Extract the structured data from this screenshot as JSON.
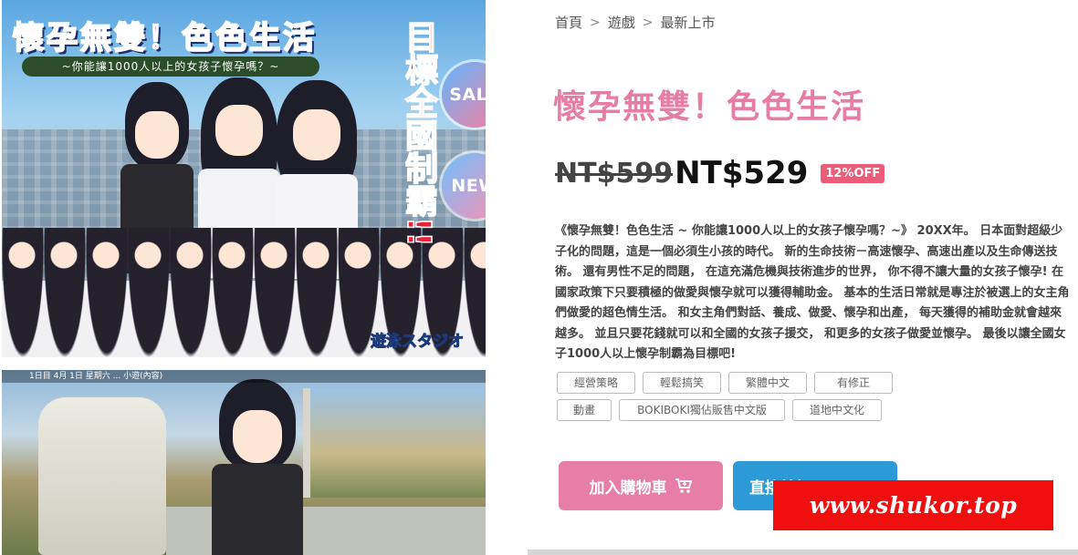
{
  "breadcrumb": {
    "items": [
      "首頁",
      "遊戲",
      "最新上市"
    ],
    "separator": ">"
  },
  "hero": {
    "title": "懷孕無雙！色色生活",
    "subtitle": "~你能讓1000人以上的女孩子懷孕嗎？~",
    "vertical_text": "目標全國制霸!!",
    "badge_sale": "SALE",
    "badge_new": "NEW",
    "studio": "遊泳スタジオ"
  },
  "scene": {
    "hud_text": "1日目 4月 1日 星期六 ... 小遊(內容)"
  },
  "product": {
    "title": "懷孕無雙！色色生活",
    "price_original": "NT$599",
    "price_sale": "NT$529",
    "discount": "12%OFF",
    "description": "《懷孕無雙！色色生活 ~ 你能讓1000人以上的女孩子懷孕嗎？~》 20XX年。 日本面對超級少子化的問題，這是一個必須生小孩的時代。 新的生命技術－高速懷孕、高速出產以及生命傳送技術。 還有男性不足的問題， 在這充滿危機與技術進步的世界， 你不得不讓大量的女孩子懷孕! 在國家政策下只要積極的做愛與懷孕就可以獲得輔助金。 基本的生活日常就是專注於被選上的女主角們做愛的超色情生活。 和女主角們對話、養成、做愛、懷孕和出產， 每天獲得的補助金就會越來越多。 並且只要花錢就可以和全國的女孩子援交， 和更多的女孩子做愛並懷孕。 最後以讓全國女子1000人以上懷孕制霸為目標吧!",
    "tags": [
      "經營策略",
      "輕鬆搞笑",
      "繁體中文",
      "有修正",
      "動畫",
      "BOKIBOKI獨佔販售中文版",
      "道地中文化"
    ]
  },
  "buttons": {
    "add_to_cart": "加入購物車",
    "buy_now": "直接結帳"
  },
  "watermark": "www.shukor.top",
  "colors": {
    "title_pink": "#e57da5",
    "cart_button": "#e77ea8",
    "buy_button": "#2b9ad6",
    "discount_badge": "#ea5c78",
    "watermark_red": "#ef0f0f"
  }
}
